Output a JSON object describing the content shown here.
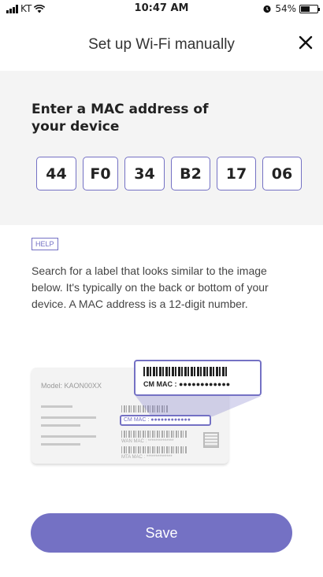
{
  "status_bar": {
    "carrier": "KT",
    "time": "10:47 AM",
    "battery": "54%",
    "battery_level": 0.54,
    "icons": [
      "signal-icon",
      "wifi-icon",
      "alarm-icon",
      "battery-icon"
    ]
  },
  "header": {
    "title": "Set up Wi-Fi manually",
    "close_icon": "close-icon"
  },
  "mac_entry": {
    "heading": "Enter a MAC address of your device",
    "segments": [
      "44",
      "F0",
      "34",
      "B2",
      "17",
      "06"
    ]
  },
  "help": {
    "badge": "HELP",
    "text": "Search for a label that looks similar to the image below. It's typically on the back or bottom of your device. A MAC address is a 12-digit number."
  },
  "illustration": {
    "model": "Model: KAON00XX",
    "cm_mac_zoom": "CM MAC : ●●●●●●●●●●●●",
    "cm_mac_small": "CM MAC : ●●●●●●●●●●●●",
    "wan_mac": "WAN MAC : **************",
    "mta_mac": "MTA MAC : **************"
  },
  "actions": {
    "save_label": "Save"
  },
  "colors": {
    "accent": "#7471c4",
    "panel_bg": "#f4f4f4"
  }
}
